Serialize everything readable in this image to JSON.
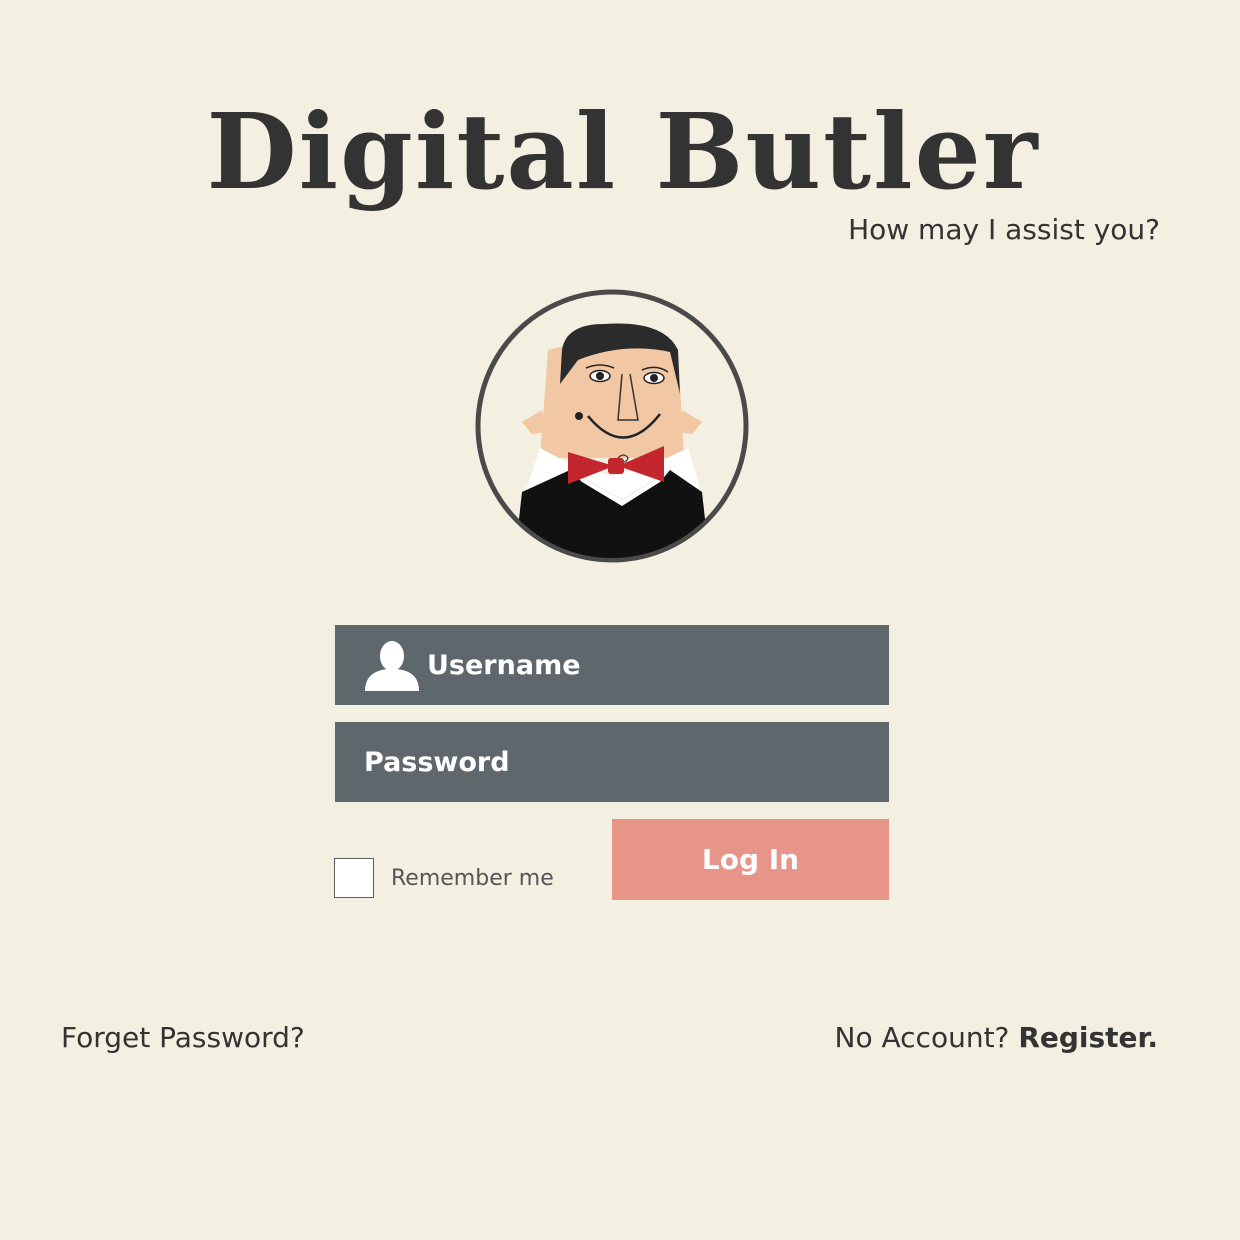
{
  "app": {
    "title": "Digital Butler",
    "tagline": "How may I assist you?"
  },
  "icons": {
    "avatar": "butler-avatar",
    "username": "user-icon"
  },
  "colors": {
    "background": "#f3efe1",
    "field": "#5e676c",
    "login_button": "#e79489",
    "text": "#333333"
  },
  "form": {
    "username_placeholder": "Username",
    "password_placeholder": "Password",
    "remember_checked": false,
    "remember_label": "Remember me",
    "login_label": "Log In"
  },
  "footer": {
    "forgot_label": "Forget Password?",
    "no_account_label": "No Account?",
    "register_label": "Register."
  }
}
